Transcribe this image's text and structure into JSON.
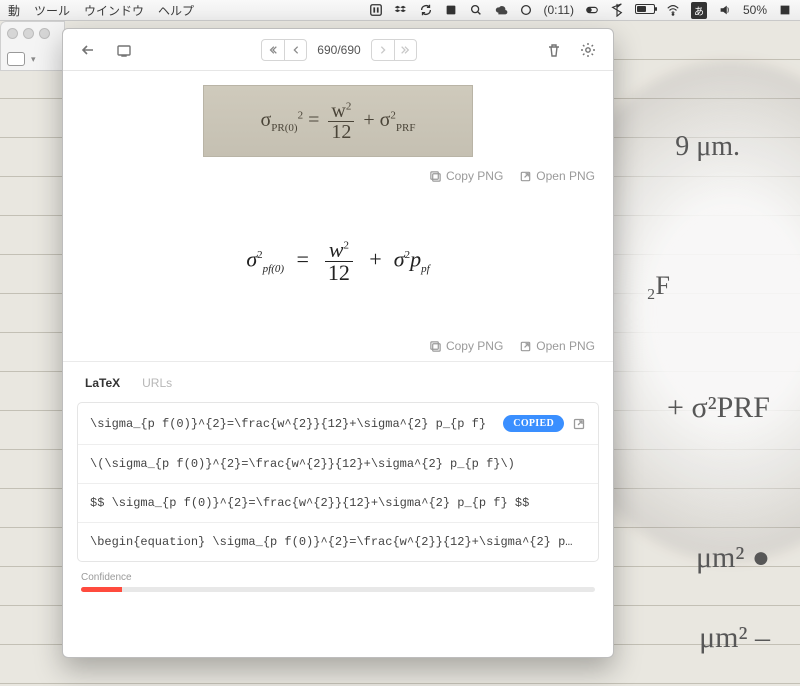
{
  "menubar": {
    "items": [
      "動",
      "ツール",
      "ウインドウ",
      "ヘルプ"
    ],
    "clock": "(0:11)",
    "battery_pct": "50%",
    "ime": "あ"
  },
  "handwriting": {
    "a": "9 μm.",
    "b": "₂F",
    "c": "+ σ²PRF",
    "d": "μm² ●",
    "e": "μm² –"
  },
  "toolbar": {
    "page_indicator": "690/690"
  },
  "snip": {
    "text_html": "σ<span class='sub'>PR(0)</span><span class='sup'>2</span>&nbsp;=&nbsp;<span class='frac'><span class='n'>w<span class='sup'>2</span></span><span class='bar'></span><span class='d'>12</span></span>&nbsp;+&nbsp;σ<span class='sup'>2</span><span class='sub'>PRF</span>"
  },
  "actions": {
    "copy_png": "Copy PNG",
    "open_png": "Open PNG"
  },
  "render": {
    "html": "<span>σ</span><span class='sup rm'>2</span><span class='sub'>pf(0)</span> &nbsp;=&nbsp; <span class='frac'><span class='n'>w<span class='sup rm'>2</span></span><span class='bar'></span><span class='d rm'>12</span></span> &nbsp;+&nbsp; σ<span class='sup rm'>2</span>p<span class='sub'>pf</span>"
  },
  "tabs": {
    "latex": "LaTeX",
    "urls": "URLs"
  },
  "latex": {
    "rows": [
      "\\sigma_{p f(0)}^{2}=\\frac{w^{2}}{12}+\\sigma^{2} p_{p f}",
      "\\(\\sigma_{p f(0)}^{2}=\\frac{w^{2}}{12}+\\sigma^{2} p_{p f}\\)",
      "$$ \\sigma_{p f(0)}^{2}=\\frac{w^{2}}{12}+\\sigma^{2} p_{p f} $$",
      "\\begin{equation} \\sigma_{p f(0)}^{2}=\\frac{w^{2}}{12}+\\sigma^{2} p…"
    ],
    "copied_badge": "COPIED"
  },
  "confidence": {
    "label": "Confidence",
    "percent": 8
  }
}
